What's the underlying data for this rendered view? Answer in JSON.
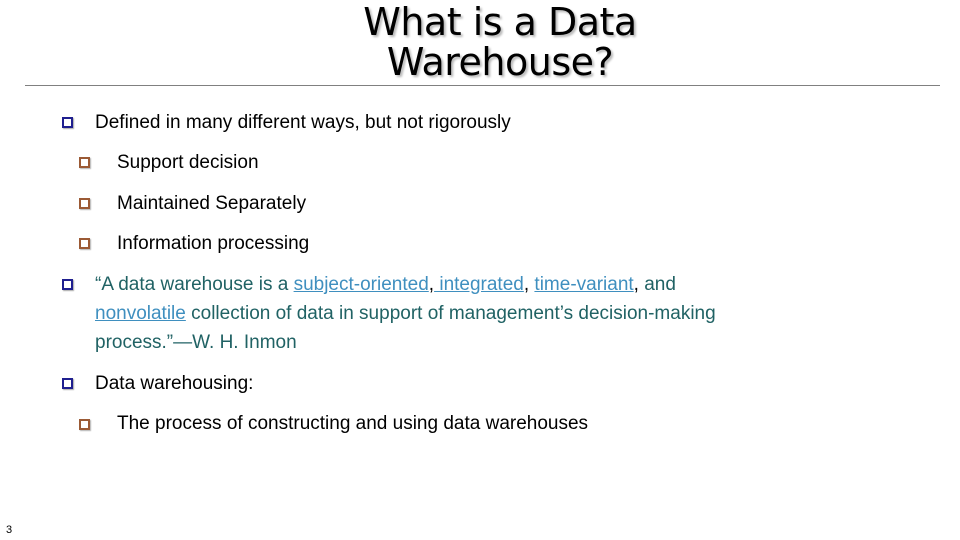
{
  "slide": {
    "title_line1": "What is a Data",
    "title_line2": "Warehouse?",
    "page_number": "3",
    "colors": {
      "level1_bullet": "#1f1f8f",
      "level2_bullet": "#9b5a35",
      "quote_text": "#206264",
      "term_link": "#3f8fbf"
    },
    "bullets": [
      {
        "text": "Defined in many different ways, but not rigorously",
        "sub": [
          "Support decision",
          "Maintained Separately",
          "Information processing"
        ]
      },
      {
        "quote": {
          "pre": "“A data warehouse is a ",
          "term1": "subject-oriented",
          "sep1": ",",
          "term2": " integrated",
          "sep2": ", ",
          "term3": "time-variant",
          "sep3": ",",
          "post1": " and",
          "term4": "nonvolatile",
          "post2": " collection of data in support of management’s decision-making",
          "line3": "process.”—W. H. Inmon"
        }
      },
      {
        "text": "Data warehousing:",
        "sub": [
          "The process of constructing and using data warehouses"
        ]
      }
    ]
  }
}
